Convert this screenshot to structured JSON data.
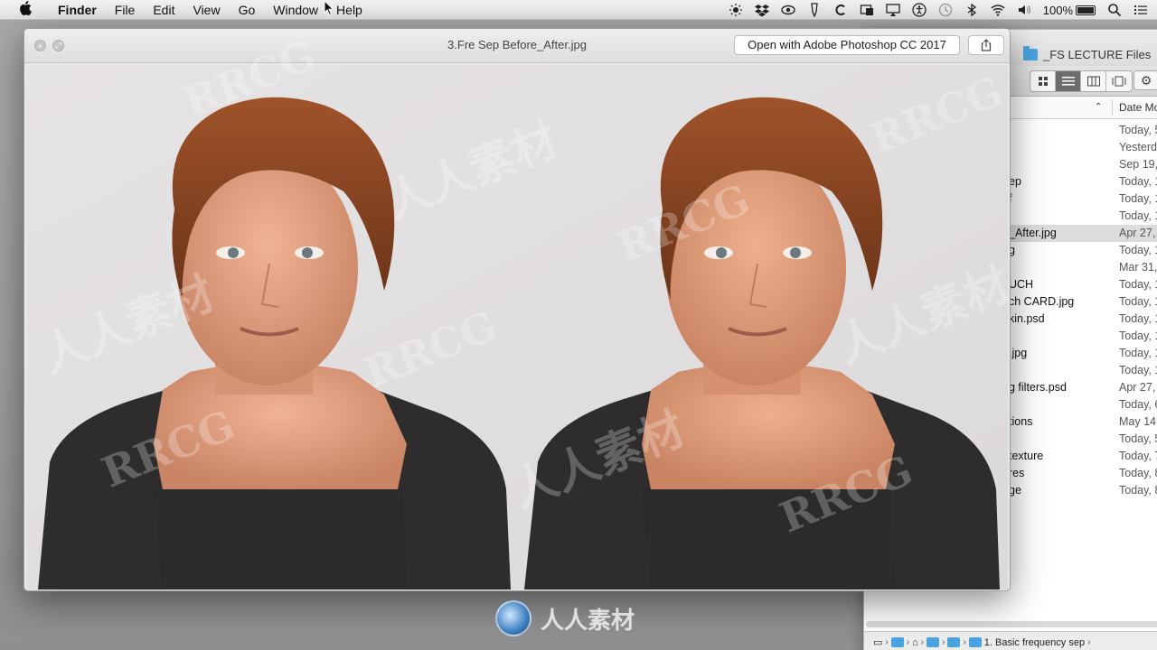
{
  "menubar": {
    "app_name": "Finder",
    "menus": [
      "File",
      "Edit",
      "View",
      "Go",
      "Window",
      "Help"
    ],
    "battery_text": "100%",
    "status_icons": [
      "brightness-icon",
      "dropbox-icon",
      "eye-icon",
      "pen-icon",
      "c-icon",
      "window-icon",
      "airplay-icon",
      "accessibility-icon",
      "time-machine-icon",
      "bluetooth-icon",
      "wifi-icon",
      "volume-icon",
      "battery-icon",
      "search-icon",
      "list-icon"
    ]
  },
  "quicklook": {
    "title": "3.Fre Sep Before_After.jpg",
    "open_button": "Open with Adobe Photoshop CC 2017",
    "share_icon": "share-icon"
  },
  "finder": {
    "title": "_FS LECTURE Files",
    "column_header_date": "Date Mo",
    "rows": [
      {
        "name": "",
        "date": "Today, 5"
      },
      {
        "name": "",
        "date": "Yesterd"
      },
      {
        "name": "",
        "date": "Sep 19,"
      },
      {
        "name": "ep",
        "date": "Today, 1"
      },
      {
        "name": "f",
        "date": "Today, 1"
      },
      {
        "name": "",
        "date": "Today, 1"
      },
      {
        "name": "_After.jpg",
        "date": "Apr 27,",
        "selected": true
      },
      {
        "name": "g",
        "date": "Today, 1"
      },
      {
        "name": "",
        "date": "Mar 31,"
      },
      {
        "name": "UCH",
        "date": "Today, 1"
      },
      {
        "name": "ch CARD.jpg",
        "date": "Today, 1"
      },
      {
        "name": "kin.psd",
        "date": "Today, 1"
      },
      {
        "name": "",
        "date": "Today, 1"
      },
      {
        "name": ".jpg",
        "date": "Today, 1"
      },
      {
        "name": "",
        "date": "Today, 1"
      },
      {
        "name": "g filters.psd",
        "date": "Apr 27,"
      },
      {
        "name": "",
        "date": "Today, 6"
      },
      {
        "name": "tions",
        "date": "May 14,"
      },
      {
        "name": "",
        "date": "Today, 5"
      },
      {
        "name": "texture",
        "date": "Today, 7"
      },
      {
        "name": "res",
        "date": "Today, 8"
      },
      {
        "name": "ge",
        "date": "Today, 8"
      }
    ],
    "pathbar_last": "1. Basic frequency sep"
  },
  "watermarks": {
    "text_latin": "RRCG",
    "text_cjk": "人人素材",
    "logo_text": "人人素材"
  },
  "colors": {
    "finder_folder": "#4aa3df",
    "selected_row": "#dcdcdc"
  }
}
